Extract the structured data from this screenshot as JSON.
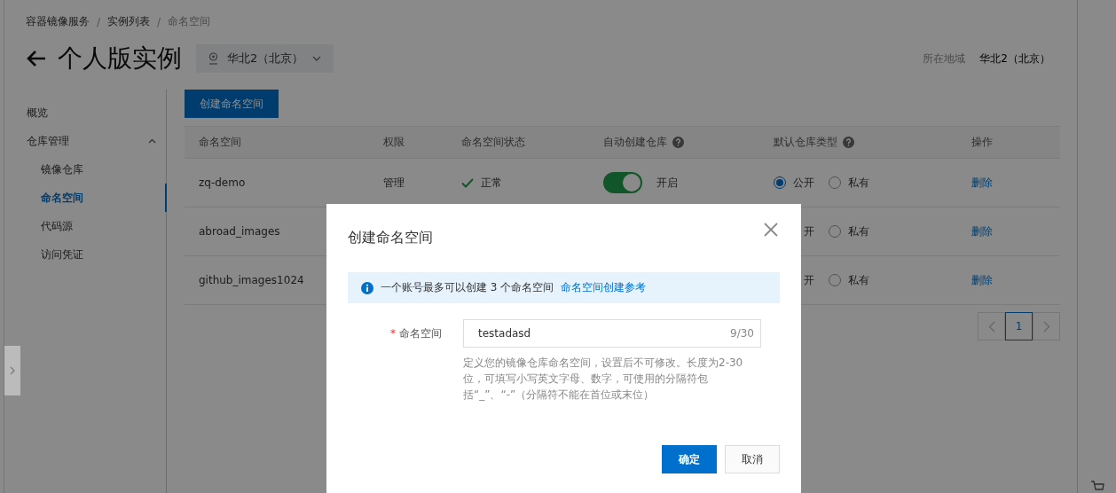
{
  "breadcrumb": [
    "容器镜像服务",
    "实例列表",
    "命名空间"
  ],
  "breadcrumb_separator": "/",
  "title": "个人版实例",
  "region_selector": {
    "value": "华北2（北京）"
  },
  "region_info": {
    "label": "所在地域",
    "value": "华北2（北京）"
  },
  "sidebar": {
    "items": [
      {
        "label": "概览",
        "selected": false
      },
      {
        "label": "仓库管理",
        "selected": false,
        "expanded": true,
        "children": [
          {
            "label": "镜像仓库",
            "selected": false
          },
          {
            "label": "命名空间",
            "selected": true
          },
          {
            "label": "代码源",
            "selected": false
          },
          {
            "label": "访问凭证",
            "selected": false
          }
        ]
      }
    ]
  },
  "create_button": "创建命名空间",
  "table": {
    "columns": [
      {
        "label": "命名空间",
        "help": false
      },
      {
        "label": "权限",
        "help": false
      },
      {
        "label": "命名空间状态",
        "help": false
      },
      {
        "label": "自动创建仓库",
        "help": true
      },
      {
        "label": "默认仓库类型",
        "help": true
      },
      {
        "label": "操作",
        "help": false
      }
    ],
    "rows": [
      {
        "name": "zq-demo",
        "permission": "管理",
        "status": "正常",
        "auto_create": {
          "on": true,
          "label": "开启"
        },
        "types": [
          {
            "kind": "radio",
            "label": "公开",
            "selected": true
          },
          {
            "kind": "radio",
            "label": "私有",
            "selected": false
          }
        ],
        "action": "删除"
      },
      {
        "name": "abroad_images",
        "types": [
          {
            "kind": "covered",
            "label": "开"
          },
          {
            "kind": "radio",
            "label": "私有",
            "selected": false
          }
        ],
        "action": "删除"
      },
      {
        "name": "github_images1024",
        "types": [
          {
            "kind": "covered",
            "label": "开"
          },
          {
            "kind": "radio",
            "label": "私有",
            "selected": false
          }
        ],
        "action": "删除"
      }
    ]
  },
  "pagination": {
    "pages": [
      {
        "label": "1",
        "selected": true
      }
    ]
  },
  "dialog": {
    "title": "创建命名空间",
    "notice": {
      "text": "一个账号最多可以创建 3 个命名空间",
      "link": "命名空间创建参考"
    },
    "field": {
      "label": "命名空间",
      "required_mark": "*",
      "value": "testadasd",
      "counter": "9/30",
      "help": "定义您的镜像仓库命名空间，设置后不可修改。长度为2-30位，可填写小写英文字母、数字，可使用的分隔符包括“_”、“-”（分隔符不能在首位或末位）"
    },
    "buttons": [
      {
        "label": "确定",
        "kind": "primary"
      },
      {
        "label": "取消",
        "kind": "secondary"
      }
    ]
  }
}
